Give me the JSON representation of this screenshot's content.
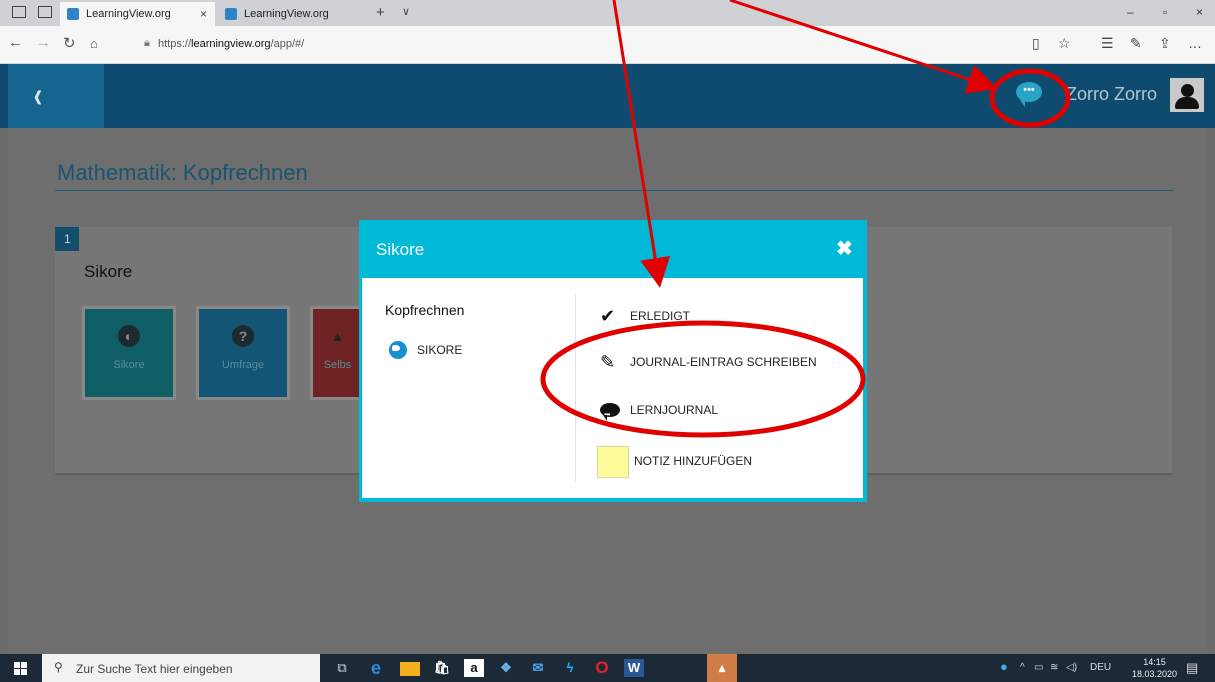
{
  "browser": {
    "tabs": [
      {
        "label": "LearningView.org",
        "close": "×"
      },
      {
        "label": "LearningView.org"
      }
    ],
    "new_tab": "+",
    "tab_menu": "∨",
    "url_prefix": "https://",
    "url_host": "learningview.org",
    "url_path": "/app/#/",
    "window_controls": [
      "–",
      "▫",
      "×"
    ]
  },
  "header": {
    "back": "‹",
    "username": "Zorro Zorro"
  },
  "page": {
    "title": "Mathematik: Kopfrechnen",
    "card": {
      "number": "1",
      "title": "Sikore",
      "tiles": [
        {
          "label": "Sikore",
          "icon": "globe-icon",
          "glyph": "◐"
        },
        {
          "label": "Umfrage",
          "icon": "question-icon",
          "glyph": "?"
        },
        {
          "label": "Selbs",
          "icon": "graduation-cap-icon",
          "glyph": "▲"
        }
      ]
    }
  },
  "modal": {
    "title": "Sikore",
    "close": "✖",
    "course": "Kopfrechnen",
    "activity": "SIKORE",
    "actions": {
      "done": "ERLEDIGT",
      "journal_entry": "JOURNAL-EINTRAG SCHREIBEN",
      "learning_journal": "LERNJOURNAL",
      "add_note": "NOTIZ HINZUFÜGEN"
    }
  },
  "taskbar": {
    "search_placeholder": "Zur Suche Text hier eingeben",
    "language": "DEU",
    "time": "14:15",
    "date": "18.03.2020"
  },
  "colors": {
    "annotation": "#e00000",
    "modal_header": "#00b9d6",
    "app_header": "#0e4b6e",
    "note": "#fffb9a"
  }
}
